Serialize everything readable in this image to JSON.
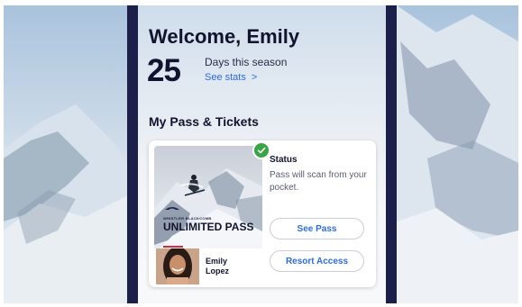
{
  "header": {
    "welcome": "Welcome, Emily",
    "days_count": "25",
    "days_label": "Days this season",
    "stats_link": "See stats",
    "stats_chevron": ">"
  },
  "passes": {
    "section_title": "My Pass & Tickets",
    "card": {
      "brand": "WHISTLER BLACKCOMB",
      "pass_title": "UNLIMITED PASS",
      "owner_first": "Emily",
      "owner_last": "Lopez",
      "status_label": "Status",
      "status_text": "Pass will scan from your pocket.",
      "see_pass_label": "See Pass",
      "resort_access_label": "Resort Access"
    }
  },
  "icons": {
    "status": "check-icon",
    "link": "chevron-right-icon"
  },
  "colors": {
    "primary_text": "#11142e",
    "link_blue": "#2c6be0",
    "status_green": "#3aa346",
    "frame_navy": "#1c1f4a",
    "accent_red": "#d62a3c"
  }
}
